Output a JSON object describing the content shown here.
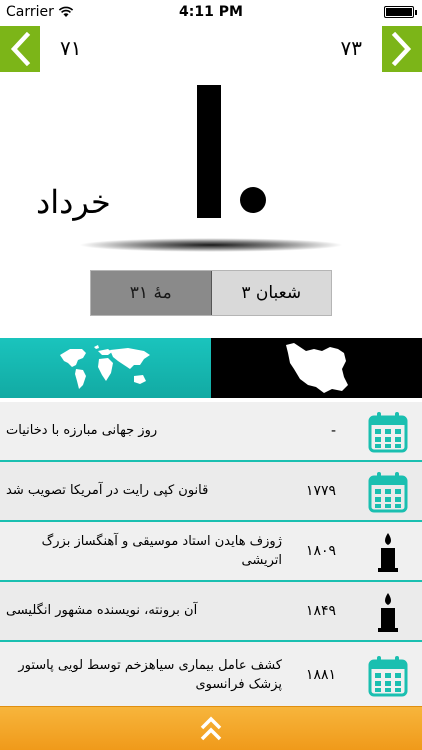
{
  "status_bar": {
    "carrier": "Carrier",
    "time": "4:11 PM"
  },
  "nav": {
    "prev_number": "۷۱",
    "next_number": "۷۳",
    "accent_color": "#7cb518"
  },
  "date": {
    "day": "۱۰",
    "month": "خرداد"
  },
  "toggle": {
    "hijri_label": "۳۱ مهٔ",
    "shaban_label": "۳ شعبان"
  },
  "tabs": [
    {
      "name": "world",
      "icon": "world-map-icon"
    },
    {
      "name": "iran",
      "icon": "iran-map-icon"
    }
  ],
  "events": [
    {
      "year": "-",
      "text": "روز جهانی مبارزه با دخانیات",
      "icon": "calendar-icon"
    },
    {
      "year": "۱۷۷۹",
      "text": "قانون کپی رایت در آمریکا تصویب شد",
      "icon": "calendar-icon"
    },
    {
      "year": "۱۸۰۹",
      "text": "ژوزف هایدن استاد موسیقی و آهنگساز بزرگ اتریشی",
      "icon": "candle-icon"
    },
    {
      "year": "۱۸۴۹",
      "text": "آن برونته، نویسنده مشهور انگلیسی",
      "icon": "candle-icon"
    },
    {
      "year": "۱۸۸۱",
      "text": "کشف عامل بیماری سیاهزخم توسط لویی پاستور پزشک فرانسوی",
      "icon": "calendar-icon"
    }
  ],
  "colors": {
    "teal": "#1ac4bd",
    "orange": "#f7b53c"
  }
}
